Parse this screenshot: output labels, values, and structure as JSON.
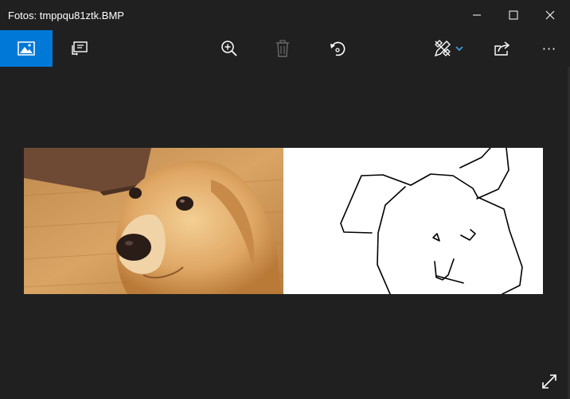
{
  "window": {
    "title": "Fotos: tmppqu81ztk.BMP"
  },
  "titlebar_buttons": {
    "minimize": "minimize-icon",
    "maximize": "maximize-icon",
    "close": "close-icon"
  },
  "toolbar": {
    "icons": [
      "image-view-icon",
      "slideshow-icon",
      "zoom-in-icon",
      "delete-icon",
      "rotate-icon",
      "edit-draw-icon",
      "chevron-down-icon",
      "share-icon",
      "more-icon"
    ],
    "more_label": "···"
  },
  "colors": {
    "background": "#202020",
    "accent": "#0078d7",
    "icon": "#ffffff",
    "icon_disabled": "#6b6b6b"
  }
}
